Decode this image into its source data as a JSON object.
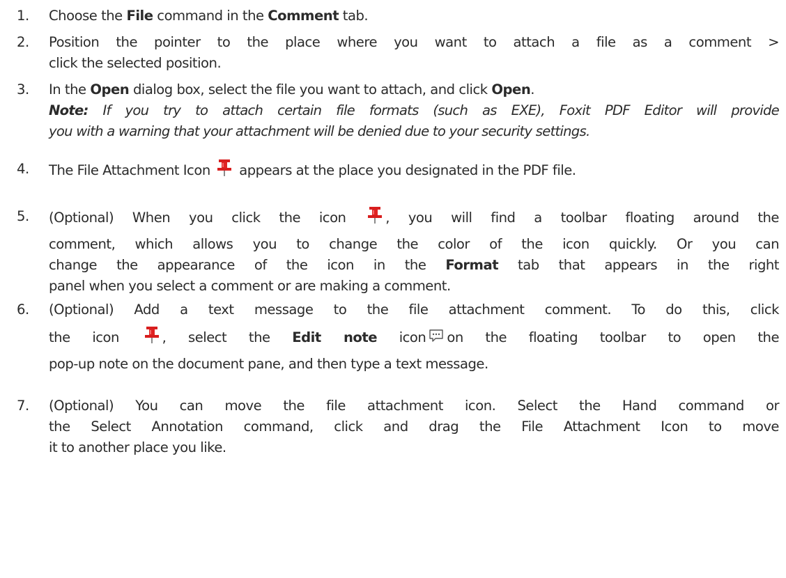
{
  "steps": [
    {
      "num": "1.",
      "t1": "Choose the ",
      "b1": "File",
      "t2": " command in the ",
      "b2": "Comment",
      "t3": " tab."
    },
    {
      "num": "2.",
      "line1": "Position the pointer to the place where you want to attach a file as a comment >",
      "line2": "click the selected position."
    },
    {
      "num": "3.",
      "t1": "In the ",
      "b1": "Open",
      "t2": " dialog box, select the file you want to attach, and click ",
      "b2": "Open",
      "t3": ".",
      "note_label": "Note:",
      "note_line1": " If you try to attach certain file formats (such as EXE), Foxit PDF Editor will provide",
      "note_line2": "you with a warning that your attachment will be denied due to your security settings."
    },
    {
      "num": "4.",
      "t1": "The File Attachment Icon",
      "t2": "appears at the place you designated in the PDF file."
    },
    {
      "num": "5.",
      "t1": "(Optional) When you click the icon",
      "t2": ", you will find a toolbar floating around the",
      "line2": "comment, which allows you to change the color of the icon quickly. Or you can",
      "l3a": "change the appearance of the icon in the ",
      "l3b": "Format",
      "l3c": " tab that appears in the right",
      "line4": "panel when you select a comment or are making a comment."
    },
    {
      "num": "6.",
      "line1": "(Optional) Add a text message to the file attachment comment. To do this, click",
      "l2a": "the icon",
      "l2b": ", select the ",
      "l2c": "Edit note",
      "l2d": " icon",
      "l2e": "on the floating toolbar to open the",
      "line3": "pop-up note on the document pane, and then type a text message."
    },
    {
      "num": "7.",
      "line1": "(Optional) You can move the file attachment icon. Select the Hand command or",
      "line2": "the Select Annotation command, click and drag the File Attachment Icon to move",
      "line3": "it to another place you like."
    }
  ],
  "icons": {
    "pin": "pushpin-icon",
    "note": "speech-bubble-icon",
    "pin_color": "#d81e1e",
    "note_color": "#555555"
  }
}
